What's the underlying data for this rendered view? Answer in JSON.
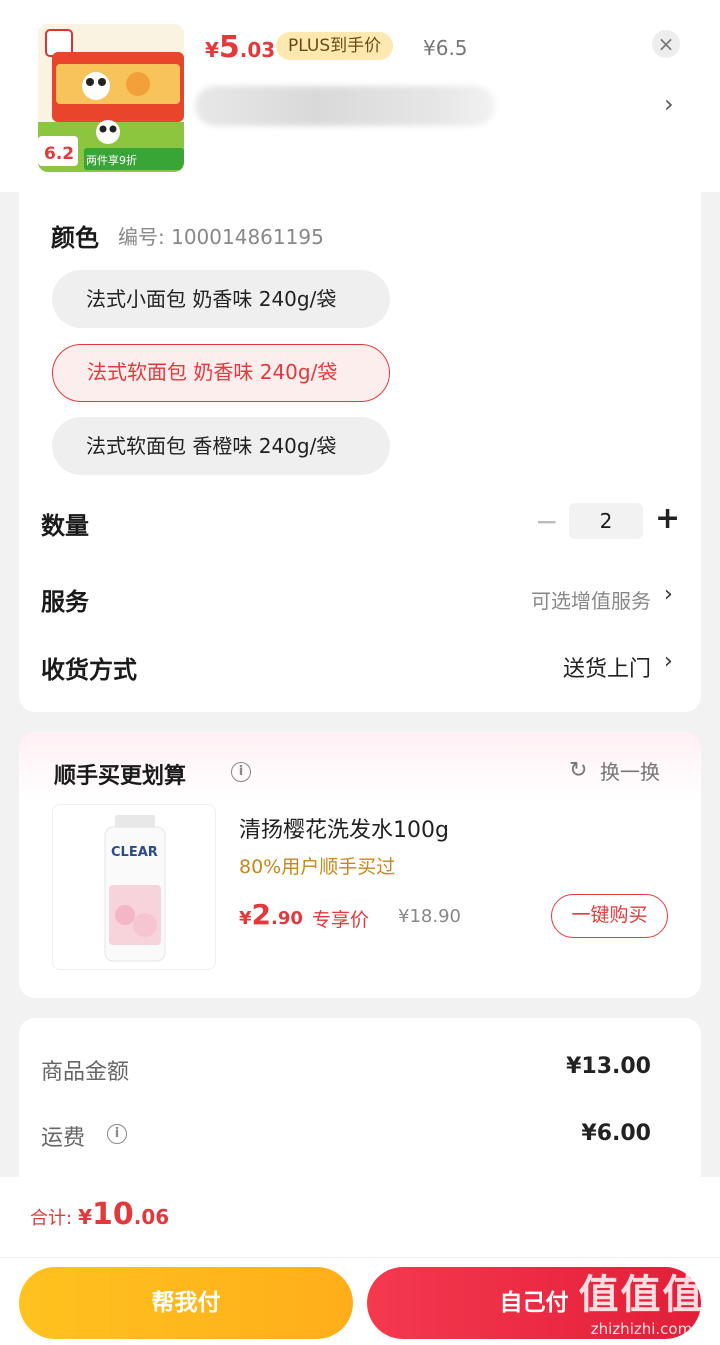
{
  "header": {
    "price": {
      "currency": "¥",
      "int": "5",
      "dec": ".03"
    },
    "plus_badge": "PLUS到手价",
    "original_price": "¥6.5",
    "close": "×",
    "chevron": "›",
    "thumb_price_tag": "6.2",
    "thumb_promo": "两件享9折"
  },
  "spec": {
    "title": "颜色",
    "sku": "编号: 100014861195",
    "options": [
      {
        "label": "法式小面包 奶香味 240g/袋",
        "selected": false
      },
      {
        "label": "法式软面包 奶香味 240g/袋",
        "selected": true
      },
      {
        "label": "法式软面包 香橙味 240g/袋",
        "selected": false
      }
    ]
  },
  "quantity": {
    "label": "数量",
    "value": "2",
    "minus": "−",
    "plus": "+"
  },
  "service": {
    "label": "服务",
    "value": "可选增值服务",
    "chevron": "›"
  },
  "delivery": {
    "label": "收货方式",
    "value": "送货上门",
    "chevron": "›"
  },
  "addon": {
    "title": "顺手买更划算",
    "refresh_label": "换一换",
    "product": {
      "name": "清扬樱花洗发水100g",
      "stat": "80%用户顺手买过",
      "price": {
        "currency": "¥",
        "int": "2",
        "dec": ".90"
      },
      "price_tag": "专享价",
      "old_price": "¥18.90",
      "buy_label": "一键购买",
      "image_brand": "CLEAR"
    }
  },
  "summary": {
    "items": [
      {
        "label": "商品金额",
        "value": "¥13.00"
      },
      {
        "label": "运费",
        "value": "¥6.00"
      }
    ]
  },
  "footer": {
    "total_label": "合计:",
    "total": {
      "currency": "¥",
      "int": "10",
      "dec": ".06"
    },
    "help_pay": "帮我付",
    "self_pay": "自己付"
  },
  "watermark": {
    "big": "值值值",
    "small": "zhizhizhi.com"
  },
  "colors": {
    "accent": "#e4393c",
    "gold": "#ffb81c",
    "bg": "#f2f2f2"
  }
}
